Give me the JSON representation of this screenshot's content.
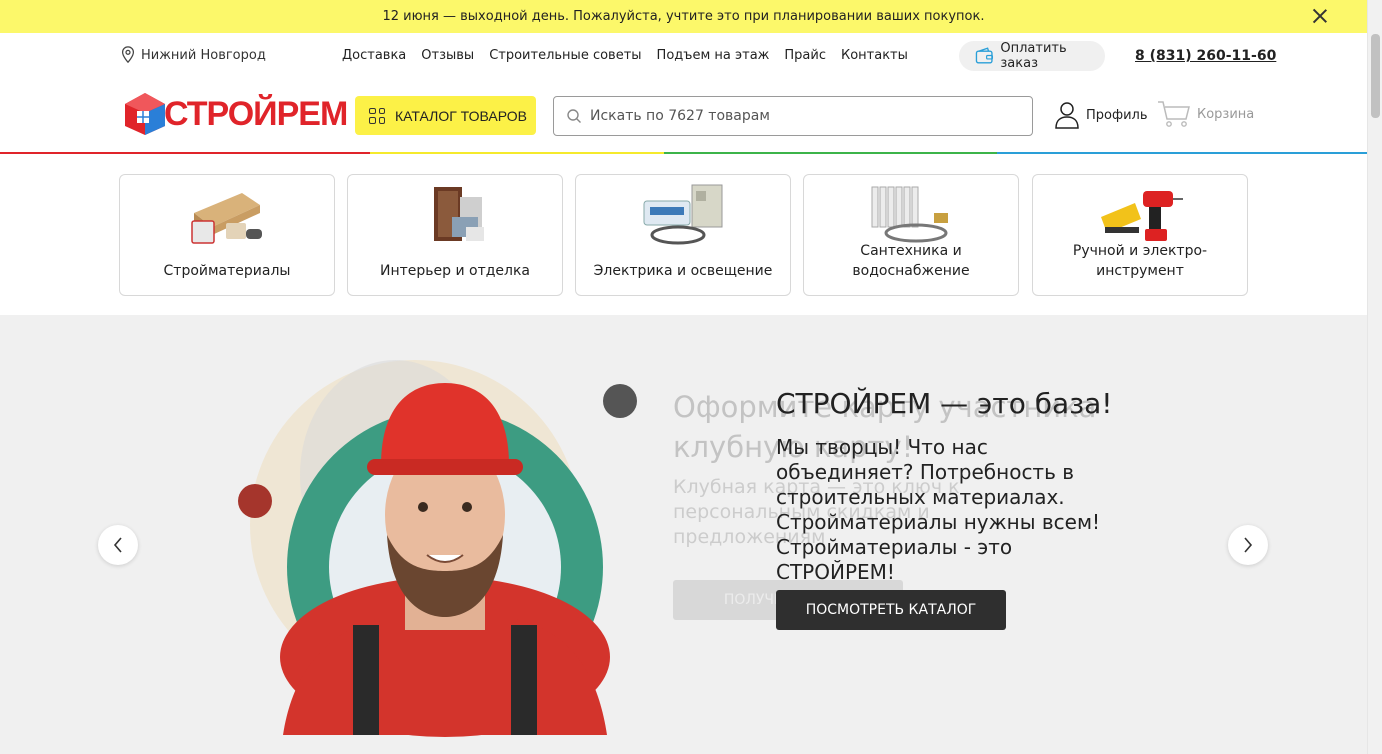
{
  "announcement": {
    "text": "12 июня — выходной день. Пожалуйста, учтите это при планировании ваших покупок."
  },
  "topbar": {
    "city": "Нижний Новгород",
    "nav": [
      "Доставка",
      "Отзывы",
      "Строительные советы",
      "Подъем на этаж",
      "Прайс",
      "Контакты"
    ],
    "pay_label": "Оплатить заказ",
    "phone": "8 (831) 260-11-60"
  },
  "header": {
    "logo_text": "СТРОЙРЕМ",
    "catalog_label": "КАТАЛОГ ТОВАРОВ",
    "search_placeholder": "Искать по 7627 товарам",
    "profile_label": "Профиль",
    "cart_label": "Корзина"
  },
  "categories": [
    {
      "label": "Стройматериалы",
      "icon": "building-materials-icon"
    },
    {
      "label": "Интерьер и отделка",
      "icon": "interior-icon"
    },
    {
      "label": "Электрика и освещение",
      "icon": "electrical-icon"
    },
    {
      "label": "Сантехника и водоснабжение",
      "icon": "plumbing-icon"
    },
    {
      "label": "Ручной и электро-инструмент",
      "icon": "tools-icon"
    }
  ],
  "hero": {
    "ghost_title": "Оформите карту участника клубную карту!",
    "ghost_sub": "Клубная карта — это ключ к персональным скидкам и предложениям",
    "ghost_button": "ПОЛУЧИТЬ КАРТУ",
    "title": "СТРОЙРЕМ — это база!",
    "description": "Мы творцы! Что нас объединяет? Потребность в строительных материалах. Стройматериалы нужны всем! Стройматериалы - это СТРОЙРЕМ!",
    "cta_label": "ПОСМОТРЕТЬ КАТАЛОГ"
  },
  "colors": {
    "announce_bg": "#fcf86a",
    "catalog_button": "#fcf147",
    "brand_red": "#e0242a",
    "hero_bg": "#f0f0f0",
    "cta_bg": "#2f2f2f"
  }
}
